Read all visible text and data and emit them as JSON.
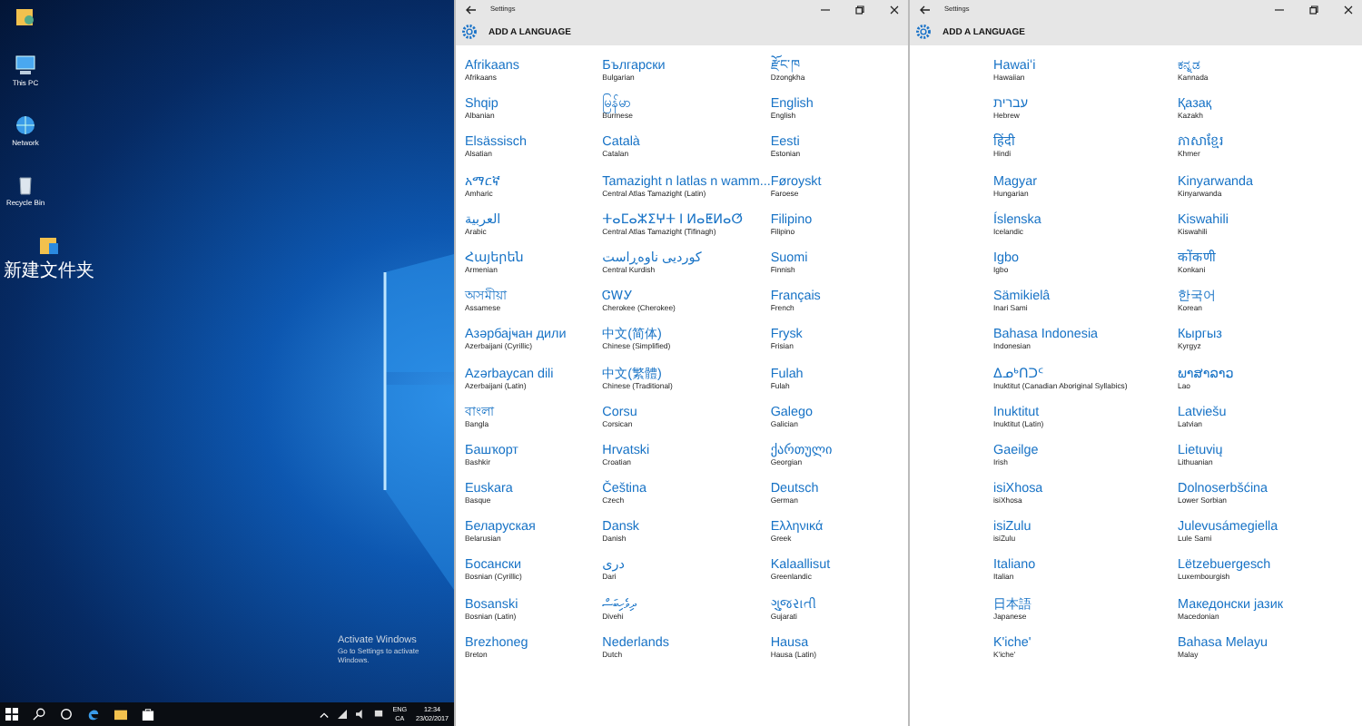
{
  "desktop": {
    "icons": [
      {
        "kind": "user-folder"
      },
      {
        "kind": "computer",
        "label": "This PC"
      },
      {
        "kind": "network",
        "label": "Network"
      },
      {
        "kind": "recycle-bin",
        "label": "Recycle Bin"
      },
      {
        "kind": "folder",
        "label": "新建文件夹"
      }
    ],
    "activation_notice": {
      "title": "Activate Windows",
      "text": "Go to Settings to activate Windows."
    }
  },
  "taskbar": {
    "apps": [
      {
        "kind": "search"
      },
      {
        "kind": "task-view"
      },
      {
        "kind": "edge"
      },
      {
        "kind": "explorer"
      },
      {
        "kind": "store"
      }
    ],
    "tray": {
      "language": "ENG",
      "layout": "CA",
      "time": "12:34",
      "date": "23/02/2017"
    }
  },
  "windows": [
    {
      "title": "Settings",
      "header": "ADD A LANGUAGE",
      "columns": [
        [
          {
            "name": "Afrikaans",
            "english": "Afrikaans"
          },
          {
            "name": "Shqip",
            "english": "Albanian"
          },
          {
            "name": "Elsässisch",
            "english": "Alsatian"
          },
          {
            "name": "አማርኛ",
            "english": "Amharic"
          },
          {
            "name": "العربية",
            "english": "Arabic"
          },
          {
            "name": "Հայերեն",
            "english": "Armenian"
          },
          {
            "name": "অসমীয়া",
            "english": "Assamese"
          },
          {
            "name": "Азәрбајҹан дили",
            "english": "Azerbaijani (Cyrillic)"
          },
          {
            "name": "Azərbaycan dili",
            "english": "Azerbaijani (Latin)"
          },
          {
            "name": "বাংলা",
            "english": "Bangla"
          },
          {
            "name": "Башҡорт",
            "english": "Bashkir"
          },
          {
            "name": "Euskara",
            "english": "Basque"
          },
          {
            "name": "Беларуская",
            "english": "Belarusian"
          },
          {
            "name": "Босански",
            "english": "Bosnian (Cyrillic)"
          },
          {
            "name": "Bosanski",
            "english": "Bosnian (Latin)"
          },
          {
            "name": "Brezhoneg",
            "english": "Breton"
          }
        ],
        [
          {
            "name": "Български",
            "english": "Bulgarian"
          },
          {
            "name": "မြန်မာ",
            "english": "Burmese"
          },
          {
            "name": "Català",
            "english": "Catalan"
          },
          {
            "name": "Tamazight n latlas n wamm...",
            "english": "Central Atlas Tamazight (Latin)"
          },
          {
            "name": "ⵜⴰⵎⴰⵣⵉⵖⵜ ⵏ ⵍⴰⵟⵍⴰⵚ",
            "english": "Central Atlas Tamazight (Tifinagh)"
          },
          {
            "name": "کوردیی ناوەڕاست",
            "english": "Central Kurdish"
          },
          {
            "name": "ᏣᎳᎩ",
            "english": "Cherokee (Cherokee)"
          },
          {
            "name": "中文(简体)",
            "english": "Chinese (Simplified)"
          },
          {
            "name": "中文(繁體)",
            "english": "Chinese (Traditional)"
          },
          {
            "name": "Corsu",
            "english": "Corsican"
          },
          {
            "name": "Hrvatski",
            "english": "Croatian"
          },
          {
            "name": "Čeština",
            "english": "Czech"
          },
          {
            "name": "Dansk",
            "english": "Danish"
          },
          {
            "name": "دری",
            "english": "Dari"
          },
          {
            "name": "ދިވެހިބަސް",
            "english": "Divehi"
          },
          {
            "name": "Nederlands",
            "english": "Dutch"
          }
        ],
        [
          {
            "name": "རྫོང་ཁ",
            "english": "Dzongkha"
          },
          {
            "name": "English",
            "english": "English"
          },
          {
            "name": "Eesti",
            "english": "Estonian"
          },
          {
            "name": "Føroyskt",
            "english": "Faroese"
          },
          {
            "name": "Filipino",
            "english": "Filipino"
          },
          {
            "name": "Suomi",
            "english": "Finnish"
          },
          {
            "name": "Français",
            "english": "French"
          },
          {
            "name": "Frysk",
            "english": "Frisian"
          },
          {
            "name": "Fulah",
            "english": "Fulah"
          },
          {
            "name": "Galego",
            "english": "Galician"
          },
          {
            "name": "ქართული",
            "english": "Georgian"
          },
          {
            "name": "Deutsch",
            "english": "German"
          },
          {
            "name": "Ελληνικά",
            "english": "Greek"
          },
          {
            "name": "Kalaallisut",
            "english": "Greenlandic"
          },
          {
            "name": "ગુજરાતી",
            "english": "Gujarati"
          },
          {
            "name": "Hausa",
            "english": "Hausa (Latin)"
          }
        ]
      ]
    },
    {
      "title": "Settings",
      "header": "ADD A LANGUAGE",
      "columns": [
        [
          {
            "name": "Hawaiʻi",
            "english": "Hawaiian"
          },
          {
            "name": "עברית",
            "english": "Hebrew"
          },
          {
            "name": "हिंदी",
            "english": "Hindi"
          },
          {
            "name": "Magyar",
            "english": "Hungarian"
          },
          {
            "name": "Íslenska",
            "english": "Icelandic"
          },
          {
            "name": "Igbo",
            "english": "Igbo"
          },
          {
            "name": "Sämikielâ",
            "english": "Inari Sami"
          },
          {
            "name": "Bahasa Indonesia",
            "english": "Indonesian"
          },
          {
            "name": "ᐃᓄᒃᑎᑐᑦ",
            "english": "Inuktitut (Canadian Aboriginal Syllabics)"
          },
          {
            "name": "Inuktitut",
            "english": "Inuktitut (Latin)"
          },
          {
            "name": "Gaeilge",
            "english": "Irish"
          },
          {
            "name": "isiXhosa",
            "english": "isiXhosa"
          },
          {
            "name": "isiZulu",
            "english": "isiZulu"
          },
          {
            "name": "Italiano",
            "english": "Italian"
          },
          {
            "name": "日本語",
            "english": "Japanese"
          },
          {
            "name": "K'iche'",
            "english": "K'iche'"
          }
        ],
        [
          {
            "name": "ಕನ್ನಡ",
            "english": "Kannada"
          },
          {
            "name": "Қазақ",
            "english": "Kazakh"
          },
          {
            "name": "ភាសាខ្មែរ",
            "english": "Khmer"
          },
          {
            "name": "Kinyarwanda",
            "english": "Kinyarwanda"
          },
          {
            "name": "Kiswahili",
            "english": "Kiswahili"
          },
          {
            "name": "कोंकणी",
            "english": "Konkani"
          },
          {
            "name": "한국어",
            "english": "Korean"
          },
          {
            "name": "Кыргыз",
            "english": "Kyrgyz"
          },
          {
            "name": "ພາສາລາວ",
            "english": "Lao"
          },
          {
            "name": "Latviešu",
            "english": "Latvian"
          },
          {
            "name": "Lietuvių",
            "english": "Lithuanian"
          },
          {
            "name": "Dolnoserbšćina",
            "english": "Lower Sorbian"
          },
          {
            "name": "Julevusámegiella",
            "english": "Lule Sami"
          },
          {
            "name": "Lëtzebuergesch",
            "english": "Luxembourgish"
          },
          {
            "name": "Македонски јазик",
            "english": "Macedonian"
          },
          {
            "name": "Bahasa Melayu",
            "english": "Malay"
          }
        ]
      ]
    }
  ]
}
